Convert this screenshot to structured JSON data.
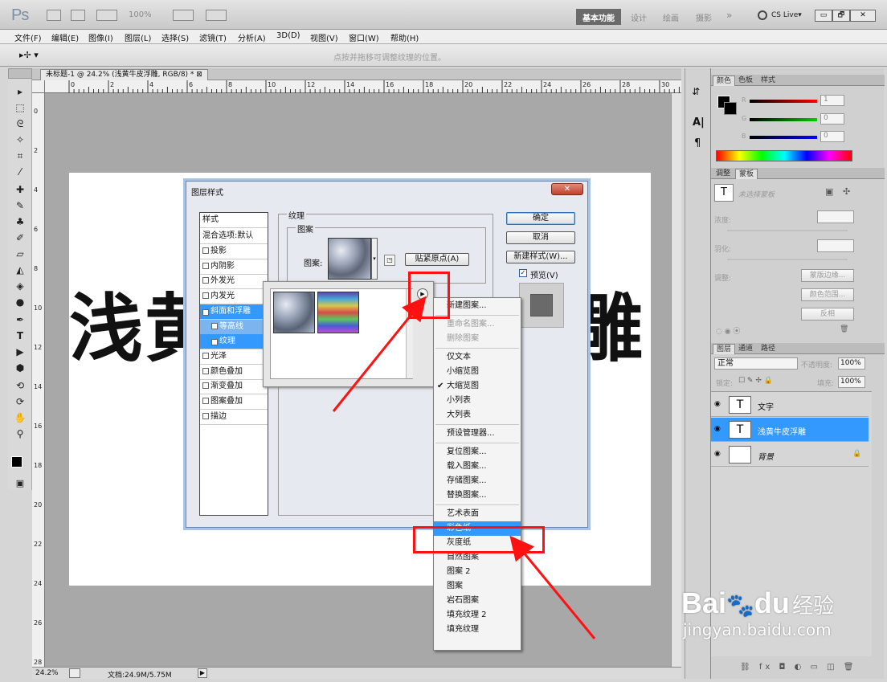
{
  "app": {
    "logo": "Ps",
    "zoom_field": "100%",
    "workspaces": [
      "基本功能",
      "设计",
      "绘画",
      "摄影"
    ],
    "more": "»",
    "cslive": "CS Live▾",
    "window_buttons": [
      "▭",
      "🗗",
      "✕"
    ]
  },
  "menu": [
    "文件(F)",
    "编辑(E)",
    "图像(I)",
    "图层(L)",
    "选择(S)",
    "滤镜(T)",
    "分析(A)",
    "3D(D)",
    "视图(V)",
    "窗口(W)",
    "帮助(H)"
  ],
  "options": {
    "hint": "点按并拖移可调整纹理的位置。"
  },
  "document": {
    "tab": "未标题-1 @ 24.2% (浅黄牛皮浮雕, RGB/8) *",
    "canvas_text_left": "浅黄",
    "canvas_text_right": "雕",
    "zoom": "24.2%",
    "doc_info": "文档:24.9M/5.75M",
    "ruler_h": [
      "0",
      "2",
      "4",
      "6",
      "8",
      "10",
      "12",
      "14",
      "16",
      "18",
      "20",
      "22",
      "24",
      "26",
      "28",
      "30"
    ],
    "ruler_v": [
      "0",
      "2",
      "4",
      "6",
      "8",
      "10",
      "12",
      "14",
      "16",
      "18",
      "20",
      "22",
      "24",
      "26",
      "28"
    ]
  },
  "color_panel": {
    "tabs": [
      "颜色",
      "色板",
      "样式"
    ],
    "channels": [
      {
        "label": "R",
        "value": "1"
      },
      {
        "label": "G",
        "value": "0"
      },
      {
        "label": "B",
        "value": "0"
      }
    ]
  },
  "adjust_panel": {
    "tabs": [
      "调整",
      "蒙板"
    ],
    "status": "未选择蒙板",
    "density": "浓度:",
    "feather": "羽化:",
    "refine": "调整:",
    "buttons": [
      "蒙版边缘...",
      "颜色范围...",
      "反相"
    ]
  },
  "layers_panel": {
    "tabs": [
      "图层",
      "通道",
      "路径"
    ],
    "blend_mode": "正常",
    "opacity_label": "不透明度:",
    "opacity": "100%",
    "lock_label": "锁定:",
    "fill_label": "填充:",
    "fill": "100%",
    "layers": [
      {
        "name": "文字",
        "thumb": "T",
        "selected": false
      },
      {
        "name": "浅黄牛皮浮雕",
        "thumb": "T",
        "selected": true
      },
      {
        "name": "背景",
        "thumb": "",
        "selected": false
      }
    ]
  },
  "dialog": {
    "title": "图层样式",
    "close": "✕",
    "styles_header": "样式",
    "blend_options": "混合选项:默认",
    "styles": [
      {
        "label": "投影",
        "checked": false
      },
      {
        "label": "内阴影",
        "checked": false
      },
      {
        "label": "外发光",
        "checked": false
      },
      {
        "label": "内发光",
        "checked": false
      },
      {
        "label": "斜面和浮雕",
        "checked": true
      },
      {
        "label": "等高线",
        "checked": false
      },
      {
        "label": "纹理",
        "checked": true
      },
      {
        "label": "光泽",
        "checked": false
      },
      {
        "label": "颜色叠加",
        "checked": false
      },
      {
        "label": "渐变叠加",
        "checked": false
      },
      {
        "label": "图案叠加",
        "checked": false
      },
      {
        "label": "描边",
        "checked": false
      }
    ],
    "group_texture": "纹理",
    "group_pattern": "图案",
    "pattern_label": "图案:",
    "snap_origin": "贴紧原点(A)",
    "ok": "确定",
    "cancel": "取消",
    "new_style": "新建样式(W)...",
    "preview": "预览(V)"
  },
  "context_menu": [
    {
      "label": "新建图案...",
      "state": "normal"
    },
    {
      "sep": true
    },
    {
      "label": "重命名图案...",
      "state": "disabled"
    },
    {
      "label": "删除图案",
      "state": "disabled"
    },
    {
      "sep": true
    },
    {
      "label": "仅文本",
      "state": "normal"
    },
    {
      "label": "小缩览图",
      "state": "normal"
    },
    {
      "label": "大缩览图",
      "state": "checked"
    },
    {
      "label": "小列表",
      "state": "normal"
    },
    {
      "label": "大列表",
      "state": "normal"
    },
    {
      "sep": true
    },
    {
      "label": "预设管理器...",
      "state": "normal"
    },
    {
      "sep": true
    },
    {
      "label": "复位图案...",
      "state": "normal"
    },
    {
      "label": "载入图案...",
      "state": "normal"
    },
    {
      "label": "存储图案...",
      "state": "normal"
    },
    {
      "label": "替换图案...",
      "state": "normal"
    },
    {
      "sep": true
    },
    {
      "label": "艺术表面",
      "state": "normal"
    },
    {
      "label": "彩色纸",
      "state": "highlight"
    },
    {
      "label": "灰度纸",
      "state": "normal"
    },
    {
      "label": "自然图案",
      "state": "normal"
    },
    {
      "label": "图案 2",
      "state": "normal"
    },
    {
      "label": "图案",
      "state": "normal"
    },
    {
      "label": "岩石图案",
      "state": "normal"
    },
    {
      "label": "填充纹理 2",
      "state": "normal"
    },
    {
      "label": "填充纹理",
      "state": "normal"
    }
  ],
  "watermark": {
    "brand": "Bai",
    "brand2": "du",
    "cn": "经验",
    "url": "jingyan.baidu.com"
  },
  "colors": {
    "accent": "#3399ff",
    "annotation": "#ff1111",
    "dialog_bg": "#e6e9ef"
  }
}
